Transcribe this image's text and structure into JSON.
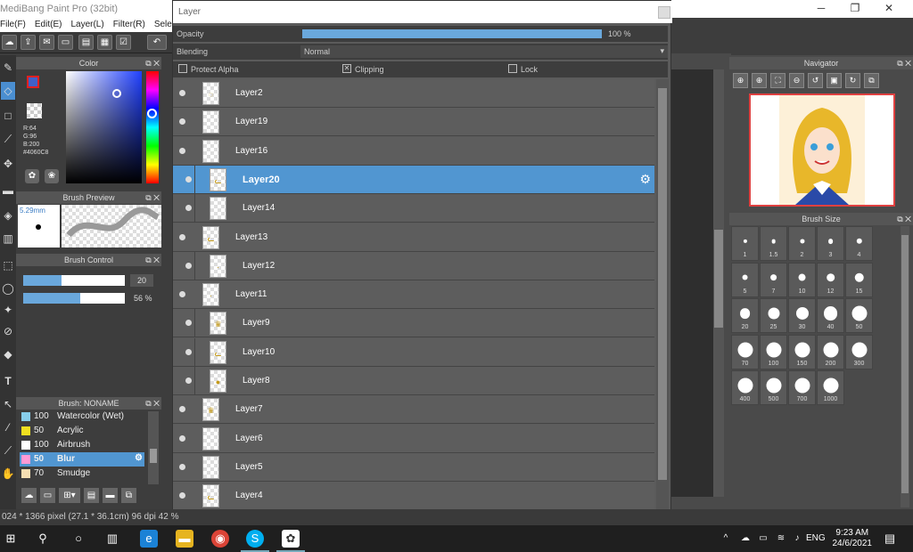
{
  "app": {
    "title": "MediBang Paint Pro (32bit)"
  },
  "window_controls": {
    "minimize": "─",
    "maximize": "❐",
    "close": "✕"
  },
  "menu": [
    "File(F)",
    "Edit(E)",
    "Layer(L)",
    "Filter(R)",
    "Select"
  ],
  "layer_dialog": {
    "title": "Layer",
    "opacity_label": "Opacity",
    "opacity_value": "100 %",
    "opacity_fraction": 1.0,
    "blending_label": "Blending",
    "blending_value": "Normal",
    "protect_alpha": "Protect Alpha",
    "clipping": "Clipping",
    "lock": "Lock",
    "layers": [
      {
        "name": "Layer2",
        "indent": false,
        "selected": false
      },
      {
        "name": "Layer19",
        "indent": false,
        "selected": false
      },
      {
        "name": "Layer16",
        "indent": false,
        "selected": false
      },
      {
        "name": "Layer20",
        "indent": true,
        "selected": true
      },
      {
        "name": "Layer14",
        "indent": true,
        "selected": false
      },
      {
        "name": "Layer13",
        "indent": false,
        "selected": false
      },
      {
        "name": "Layer12",
        "indent": true,
        "selected": false
      },
      {
        "name": "Layer11",
        "indent": false,
        "selected": false
      },
      {
        "name": "Layer9",
        "indent": true,
        "selected": false
      },
      {
        "name": "Layer10",
        "indent": true,
        "selected": false
      },
      {
        "name": "Layer8",
        "indent": true,
        "selected": false
      },
      {
        "name": "Layer7",
        "indent": false,
        "selected": false
      },
      {
        "name": "Layer6",
        "indent": false,
        "selected": false
      },
      {
        "name": "Layer5",
        "indent": false,
        "selected": false
      },
      {
        "name": "Layer4",
        "indent": false,
        "selected": false
      }
    ]
  },
  "color_panel": {
    "title": "Color",
    "r": "R:64",
    "g": "G:96",
    "b": "B:200",
    "hex": "#4060C8",
    "fg_color": "#4060C8"
  },
  "brush_preview": {
    "title": "Brush Preview",
    "size": "5.29mm"
  },
  "brush_control": {
    "title": "Brush Control",
    "size_value": "20",
    "opacity_value": "56 %",
    "size_fraction": 0.38,
    "opacity_fraction": 0.56
  },
  "brush_list": {
    "title": "Brush: NONAME",
    "items": [
      {
        "size": "100",
        "name": "Watercolor (Wet)",
        "color": "#87ceeb"
      },
      {
        "size": "50",
        "name": "Acrylic",
        "color": "#f0e020"
      },
      {
        "size": "100",
        "name": "Airbrush",
        "color": "#ffffff"
      },
      {
        "size": "50",
        "name": "Blur",
        "color": "#ff9ad6"
      },
      {
        "size": "70",
        "name": "Smudge",
        "color": "#f5deb3"
      }
    ]
  },
  "navigator": {
    "title": "Navigator"
  },
  "brush_size": {
    "title": "Brush Size",
    "values": [
      "1",
      "1.5",
      "2",
      "3",
      "4",
      "5",
      "7",
      "10",
      "12",
      "15",
      "20",
      "25",
      "30",
      "40",
      "50",
      "70",
      "100",
      "150",
      "200",
      "300",
      "400",
      "500",
      "700",
      "1000"
    ]
  },
  "status": {
    "canvas_info": "024 * 1366 pixel  (27.1 * 36.1cm)  96 dpi  42 %"
  },
  "taskbar": {
    "time": "9:23 AM",
    "date": "24/6/2021",
    "lang": "ENG"
  }
}
